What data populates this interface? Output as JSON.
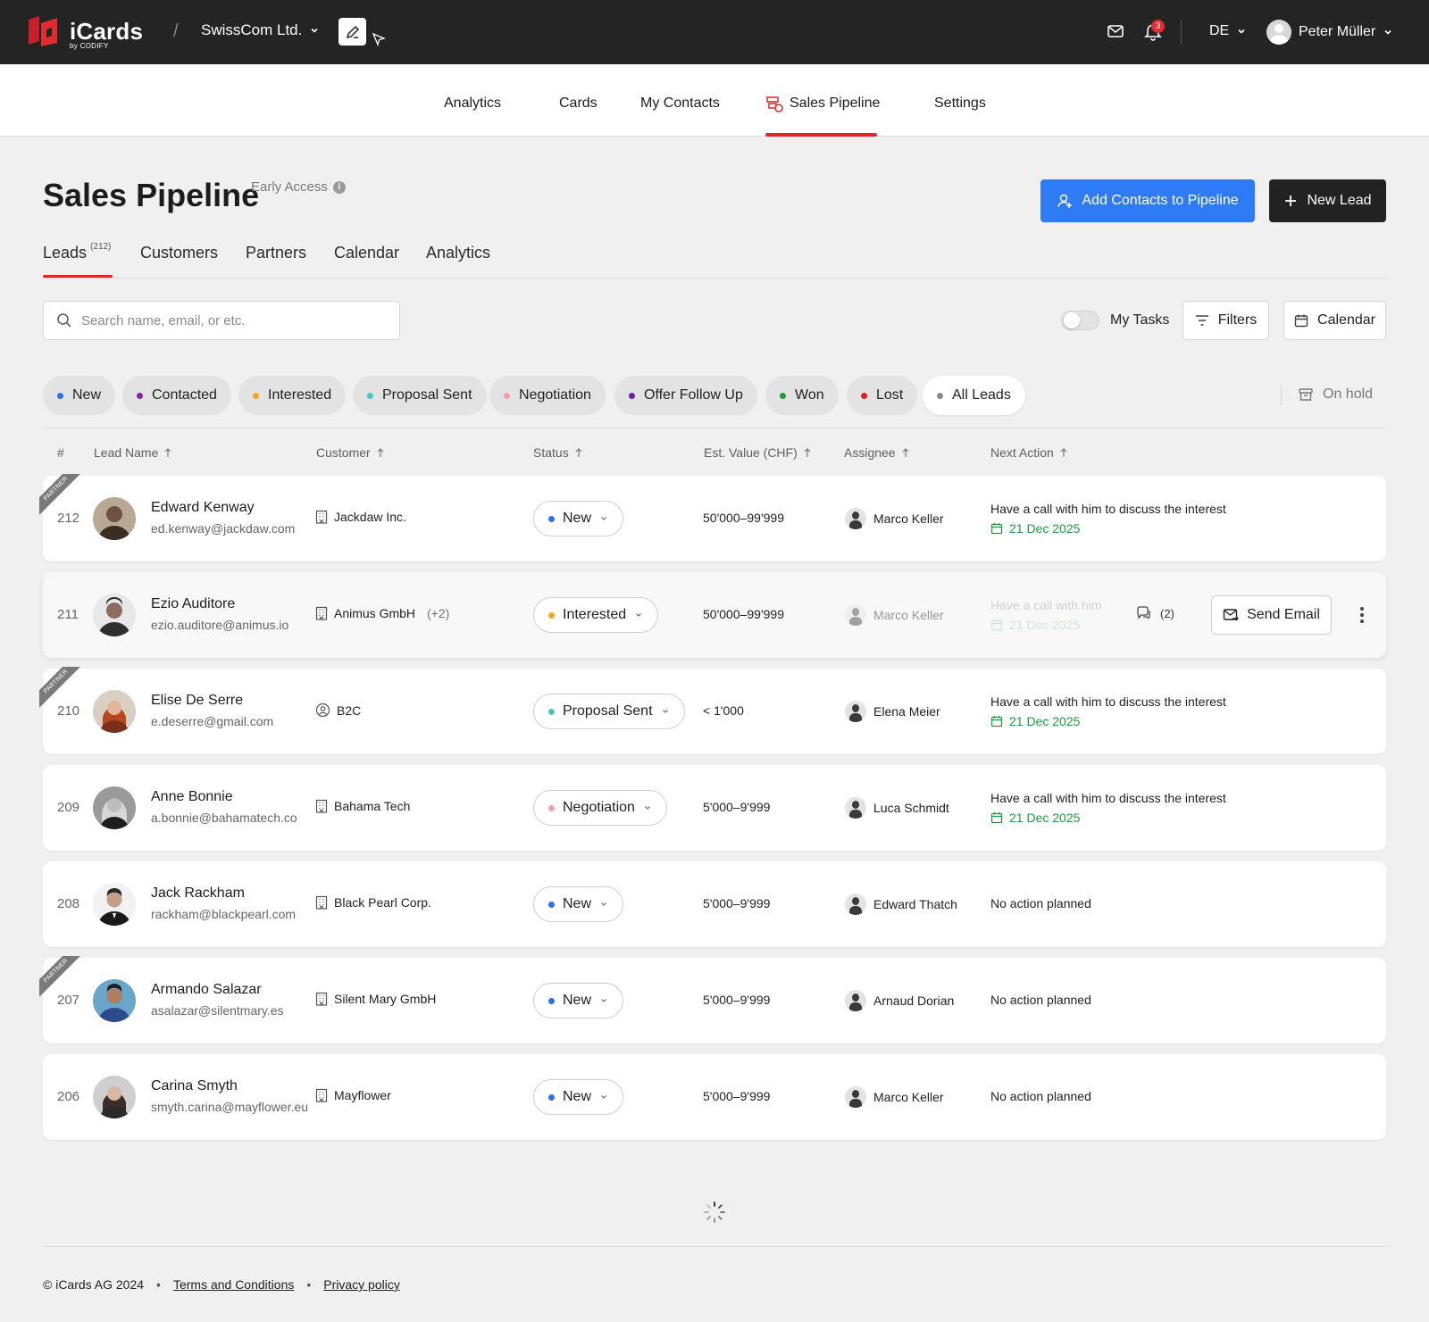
{
  "app": {
    "logo_text": "iCards",
    "logo_sub": "by CODIFY",
    "company": "SwissCom Ltd.",
    "notification_count": "3",
    "language": "DE",
    "user_name": "Peter Müller"
  },
  "main_nav": {
    "items": [
      "Analytics",
      "Cards",
      "My Contacts",
      "Sales Pipeline",
      "Settings"
    ],
    "active": "Sales Pipeline"
  },
  "page": {
    "title": "Sales Pipeline",
    "badge": "Early Access",
    "add_contacts_label": "Add Contacts to Pipeline",
    "new_lead_label": "New Lead"
  },
  "subtabs": {
    "leads": "Leads",
    "leads_count": "(212)",
    "customers": "Customers",
    "partners": "Partners",
    "calendar": "Calendar",
    "analytics": "Analytics"
  },
  "toolbar": {
    "search_placeholder": "Search name, email, or etc.",
    "my_tasks": "My Tasks",
    "filters": "Filters",
    "calendar": "Calendar"
  },
  "chips": [
    {
      "label": "New",
      "color": "#2f6fe8"
    },
    {
      "label": "Contacted",
      "color": "#8a1fa8"
    },
    {
      "label": "Interested",
      "color": "#f5a623"
    },
    {
      "label": "Proposal Sent",
      "color": "#4cc3c8"
    },
    {
      "label": "Negotiation",
      "color": "#f2a0a8"
    },
    {
      "label": "Offer Follow Up",
      "color": "#6a1fa0"
    },
    {
      "label": "Won",
      "color": "#1f9a3e"
    },
    {
      "label": "Lost",
      "color": "#e01f1f"
    },
    {
      "label": "All Leads",
      "color": "#888888"
    }
  ],
  "on_hold": "On hold",
  "table": {
    "headers": [
      "#",
      "Lead Name",
      "Customer",
      "Status",
      "Est. Value (CHF)",
      "Assignee",
      "Next Action"
    ],
    "partner_ribbon": "PARTNER",
    "send_email": "Send Email",
    "rows": [
      {
        "num": "212",
        "name": "Edward Kenway",
        "email": "ed.kenway@jackdaw.com",
        "customer": "Jackdaw Inc.",
        "customer_more": "",
        "status": "New",
        "status_color": "#2f6fe8",
        "value": "50'000–99'999",
        "assignee": "Marco Keller",
        "next_action": "Have a call with him to discuss the interest",
        "next_date": "21 Dec 2025"
      },
      {
        "num": "211",
        "name": "Ezio Auditore",
        "email": "ezio.auditore@animus.io",
        "customer": "Animus GmbH",
        "customer_more": "(+2)",
        "status": "Interested",
        "status_color": "#f5a623",
        "value": "50'000–99'999",
        "assignee": "Marco Keller",
        "next_action": "Have a call with him",
        "next_date": "21 Dec 2025",
        "comments": "(2)"
      },
      {
        "num": "210",
        "name": "Elise De Serre",
        "email": "e.deserre@gmail.com",
        "customer": "B2C",
        "customer_more": "",
        "status": "Proposal Sent",
        "status_color": "#4cc3c8",
        "value": "< 1'000",
        "assignee": "Elena Meier",
        "next_action": "Have a call with him to discuss the interest",
        "next_date": "21 Dec 2025"
      },
      {
        "num": "209",
        "name": "Anne Bonnie",
        "email": "a.bonnie@bahamatech.co",
        "customer": "Bahama Tech",
        "customer_more": "",
        "status": "Negotiation",
        "status_color": "#f2a0a8",
        "value": "5'000–9'999",
        "assignee": "Luca Schmidt",
        "next_action": "Have a call with him to discuss the interest",
        "next_date": "21 Dec 2025"
      },
      {
        "num": "208",
        "name": "Jack Rackham",
        "email": "rackham@blackpearl.com",
        "customer": "Black Pearl Corp.",
        "customer_more": "",
        "status": "New",
        "status_color": "#2f6fe8",
        "value": "5'000–9'999",
        "assignee": "Edward Thatch",
        "next_action": "No action planned",
        "next_date": ""
      },
      {
        "num": "207",
        "name": "Armando Salazar",
        "email": "asalazar@silentmary.es",
        "customer": "Silent Mary GmbH",
        "customer_more": "",
        "status": "New",
        "status_color": "#2f6fe8",
        "value": "5'000–9'999",
        "assignee": "Arnaud Dorian",
        "next_action": "No action planned",
        "next_date": ""
      },
      {
        "num": "206",
        "name": "Carina Smyth",
        "email": "smyth.carina@mayflower.eu",
        "customer": "Mayflower",
        "customer_more": "",
        "status": "New",
        "status_color": "#2f6fe8",
        "value": "5'000–9'999",
        "assignee": "Marco Keller",
        "next_action": "No action planned",
        "next_date": ""
      }
    ]
  },
  "footer": {
    "copyright": "© iCards AG 2024",
    "terms": "Terms and Conditions",
    "privacy": "Privacy policy"
  }
}
